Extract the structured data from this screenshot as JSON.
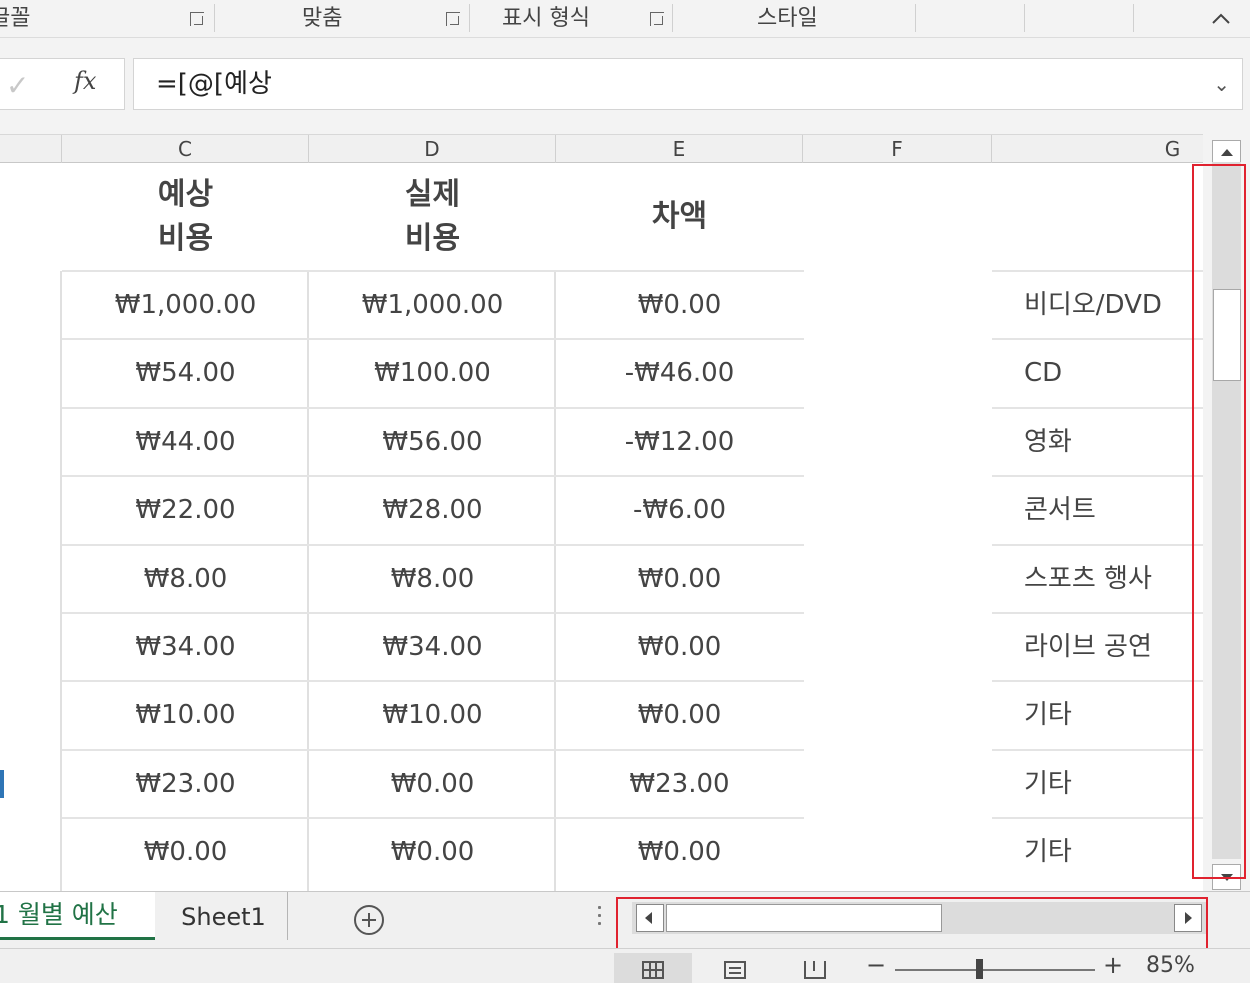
{
  "ribbon": {
    "groups": [
      {
        "label": "글꼴"
      },
      {
        "label": "맞춤"
      },
      {
        "label": "표시 형식"
      },
      {
        "label": "스타일"
      }
    ]
  },
  "formula_bar": {
    "fx_label": "fx",
    "formula": "=[@[예상"
  },
  "column_headers": [
    "C",
    "D",
    "E",
    "F",
    "G"
  ],
  "table": {
    "headers": {
      "expected": "예상\n비용",
      "actual": "실제\n비용",
      "difference": "차액"
    },
    "rows": [
      {
        "expected": "₩1,000.00",
        "actual": "₩1,000.00",
        "diff": "₩0.00",
        "category": "비디오/DVD"
      },
      {
        "expected": "₩54.00",
        "actual": "₩100.00",
        "diff": "-₩46.00",
        "category": "CD"
      },
      {
        "expected": "₩44.00",
        "actual": "₩56.00",
        "diff": "-₩12.00",
        "category": "영화"
      },
      {
        "expected": "₩22.00",
        "actual": "₩28.00",
        "diff": "-₩6.00",
        "category": "콘서트"
      },
      {
        "expected": "₩8.00",
        "actual": "₩8.00",
        "diff": "₩0.00",
        "category": "스포츠 행사"
      },
      {
        "expected": "₩34.00",
        "actual": "₩34.00",
        "diff": "₩0.00",
        "category": "라이브 공연"
      },
      {
        "expected": "₩10.00",
        "actual": "₩10.00",
        "diff": "₩0.00",
        "category": "기타"
      },
      {
        "expected": "₩23.00",
        "actual": "₩0.00",
        "diff": "₩23.00",
        "category": "기타"
      },
      {
        "expected": "₩0.00",
        "actual": "₩0.00",
        "diff": "₩0.00",
        "category": "기타"
      }
    ]
  },
  "sheet_tabs": {
    "active": "1 월별 예산",
    "other": "Sheet1"
  },
  "status_bar": {
    "zoom_minus": "−",
    "zoom_plus": "+",
    "zoom_level": "85%"
  },
  "colors": {
    "accent_green": "#217346",
    "highlight_red": "#e0222f"
  },
  "icons": [
    "dialog-launcher-icon",
    "collapse-ribbon-icon",
    "check-icon",
    "fx-icon",
    "expand-formula-icon",
    "add-sheet-icon",
    "normal-view-icon",
    "page-layout-icon",
    "page-break-icon"
  ]
}
